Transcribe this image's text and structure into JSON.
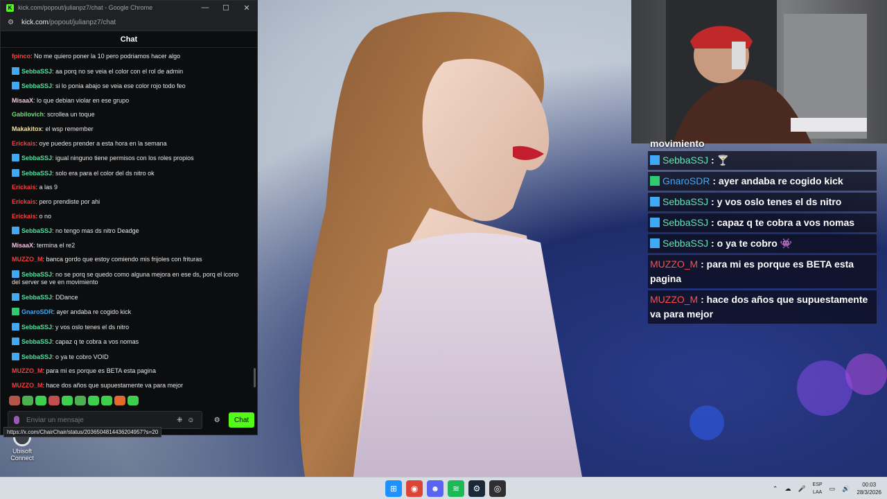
{
  "browser": {
    "title": "kick.com/popout/julianpz7/chat - Google Chrome",
    "url_host": "kick.com",
    "url_path": "/popout/julianpz7/chat",
    "minimize": "—",
    "maximize": "☐",
    "close": "✕"
  },
  "chat": {
    "header": "Chat",
    "messages": [
      {
        "user": "fpinco",
        "color": "#ff3b3b",
        "badge": "",
        "text": "No me quiero poner la 10 pero podriamos hacer algo"
      },
      {
        "user": "SebbaSSJ",
        "color": "#4ee3a2",
        "badge": "b1",
        "text": "aa porq no se veia el color con el rol de admin"
      },
      {
        "user": "SebbaSSJ",
        "color": "#4ee3a2",
        "badge": "b1",
        "text": "si lo ponia abajo se veia ese color rojo todo feo"
      },
      {
        "user": "MisaaX",
        "color": "#f5c6e0",
        "badge": "",
        "text": "lo que debian violar en ese grupo"
      },
      {
        "user": "Gabilovich",
        "color": "#6be07a",
        "badge": "",
        "text": "scrollea un toque"
      },
      {
        "user": "Makakitox",
        "color": "#f0e0a0",
        "badge": "",
        "text": "el wsp remember"
      },
      {
        "user": "Erickais",
        "color": "#ff3b3b",
        "badge": "",
        "text": "oye puedes prender a esta hora en la semana"
      },
      {
        "user": "SebbaSSJ",
        "color": "#4ee3a2",
        "badge": "b1",
        "text": "igual ninguno tiene permisos con los roles propios"
      },
      {
        "user": "SebbaSSJ",
        "color": "#4ee3a2",
        "badge": "b1",
        "text": "solo era para el color del ds nitro ok"
      },
      {
        "user": "Erickais",
        "color": "#ff3b3b",
        "badge": "",
        "text": "a las 9"
      },
      {
        "user": "Erickais",
        "color": "#ff3b3b",
        "badge": "",
        "text": "pero prendiste por ahi"
      },
      {
        "user": "Erickais",
        "color": "#ff3b3b",
        "badge": "",
        "text": "o no"
      },
      {
        "user": "SebbaSSJ",
        "color": "#4ee3a2",
        "badge": "b1",
        "text": "no tengo mas ds nitro Deadge"
      },
      {
        "user": "MisaaX",
        "color": "#f5c6e0",
        "badge": "",
        "text": "termina el re2"
      },
      {
        "user": "MUZZO_M",
        "color": "#ff3b3b",
        "badge": "",
        "text": "banca gordo que estoy comiendo mis frijoles con frituras"
      },
      {
        "user": "SebbaSSJ",
        "color": "#4ee3a2",
        "badge": "b1",
        "text": "no se porq se quedo como alguna mejora en ese ds, porq el icono del server se ve en movimiento"
      },
      {
        "user": "SebbaSSJ",
        "color": "#4ee3a2",
        "badge": "b1",
        "text": "DDance"
      },
      {
        "user": "GnaroSDR",
        "color": "#3fa9f5",
        "badge": "b2",
        "text": "ayer andaba re cogido kick"
      },
      {
        "user": "SebbaSSJ",
        "color": "#4ee3a2",
        "badge": "b1",
        "text": "y vos oslo tenes el ds nitro"
      },
      {
        "user": "SebbaSSJ",
        "color": "#4ee3a2",
        "badge": "b1",
        "text": "capaz q te cobra a vos nomas"
      },
      {
        "user": "SebbaSSJ",
        "color": "#4ee3a2",
        "badge": "b1",
        "text": "o ya te cobro VOID"
      },
      {
        "user": "MUZZO_M",
        "color": "#ff3b3b",
        "badge": "",
        "text": "para mi es porque es BETA esta pagina"
      },
      {
        "user": "MUZZO_M",
        "color": "#ff3b3b",
        "badge": "",
        "text": "hace dos años que supuestamente va para mejor"
      }
    ],
    "emote_colors": [
      "#b5554a",
      "#4caf50",
      "#3ecf4e",
      "#c0504d",
      "#3ecf4e",
      "#4caf50",
      "#3ecf4e",
      "#3ecf4e",
      "#e26a2c",
      "#3ecf4e"
    ],
    "input_placeholder": "Enviar un mensaje",
    "send_label": "Chat",
    "hover_url": "https://x.com/ChairChair/status/2036504814436204957?s=20"
  },
  "overlay": {
    "top_text": "movimiento",
    "messages": [
      {
        "user": "SebbaSSJ",
        "sep": " : ",
        "color": "#5ee8b0",
        "badge": "#3fa9f5",
        "text": "🍸"
      },
      {
        "user": "GnaroSDR",
        "sep": " : ",
        "color": "#3fa9f5",
        "badge": "#2ecc71",
        "text": "ayer andaba re cogido kick"
      },
      {
        "user": "SebbaSSJ",
        "sep": " : ",
        "color": "#5ee8b0",
        "badge": "#3fa9f5",
        "text": "y vos oslo tenes el ds nitro"
      },
      {
        "user": "SebbaSSJ",
        "sep": " : ",
        "color": "#5ee8b0",
        "badge": "#3fa9f5",
        "text": "capaz q te cobra a vos nomas"
      },
      {
        "user": "SebbaSSJ",
        "sep": " : ",
        "color": "#5ee8b0",
        "badge": "#3fa9f5",
        "text": "o ya te cobro 👾"
      },
      {
        "user": "MUZZO_M",
        "sep": " : ",
        "color": "#ff4d4d",
        "badge": "",
        "text": "para mi es porque es BETA esta pagina"
      },
      {
        "user": "MUZZO_M",
        "sep": " : ",
        "color": "#ff4d4d",
        "badge": "",
        "text": "hace dos años que supuestamente va para mejor"
      }
    ]
  },
  "desktop": {
    "icon_label": "Ubisoft Connect"
  },
  "taskbar": {
    "apps": [
      {
        "name": "windows-start",
        "color": "#1e90ff",
        "glyph": "⊞"
      },
      {
        "name": "chrome",
        "color": "#db4437",
        "glyph": "◉"
      },
      {
        "name": "discord",
        "color": "#5865f2",
        "glyph": "☻"
      },
      {
        "name": "spotify",
        "color": "#1db954",
        "glyph": "≋"
      },
      {
        "name": "steam",
        "color": "#1b2838",
        "glyph": "⚙"
      },
      {
        "name": "obs",
        "color": "#302e31",
        "glyph": "◎"
      }
    ],
    "lang_top": "ESP",
    "lang_bottom": "LAA",
    "time": "00:03",
    "date": "28/3/2026"
  }
}
